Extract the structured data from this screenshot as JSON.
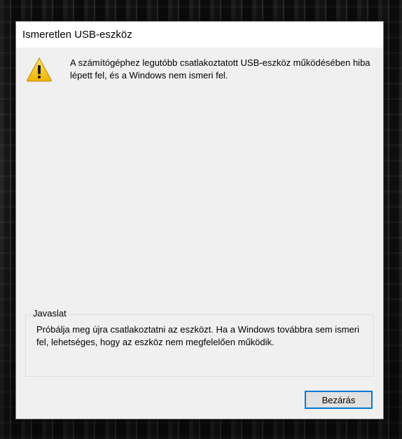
{
  "dialog": {
    "title": "Ismeretlen USB-eszköz",
    "icon": "warning-icon",
    "message": "A számítógéphez legutóbb csatlakoztatott USB-eszköz működésében hiba lépett fel, és a Windows nem ismeri fel.",
    "suggestion": {
      "legend": "Javaslat",
      "text": "Próbálja meg újra csatlakoztatni az eszközt. Ha a Windows továbbra sem ismeri fel, lehetséges, hogy az eszköz nem megfelelően működik."
    },
    "close_label": "Bezárás"
  },
  "colors": {
    "accent": "#0078d7",
    "dialog_bg": "#f0f0f0",
    "titlebar_bg": "#ffffff",
    "warning_yellow": "#f5c400"
  }
}
